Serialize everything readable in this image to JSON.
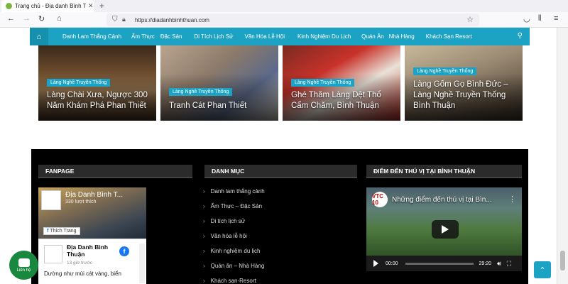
{
  "browser": {
    "tab_title": "Trang chủ - Địa danh Bình Thuận",
    "url": "https://diadanhbinhthuan.com"
  },
  "nav": {
    "items": [
      "Danh Lam Thắng Cảnh",
      "Ẩm Thực",
      "Đặc Sản",
      "Di Tích Lịch Sử",
      "Văn Hóa Lễ Hội",
      "Kinh Nghiệm Du Lịch",
      "Quán Ăn",
      "Nhà Hàng",
      "Khách Sạn Resort"
    ]
  },
  "cards": [
    {
      "tag": "Làng Nghề Truyền Thống",
      "title": "Làng Chài Xưa, Ngược 300 Năm Khám Phá Phan Thiết"
    },
    {
      "tag": "Làng Nghề Truyền Thống",
      "title": "Tranh Cát Phan Thiết"
    },
    {
      "tag": "Làng Nghề Truyền Thống",
      "title": "Ghé Thăm Làng Dệt Thổ Cẩm Chăm, Bình Thuận"
    },
    {
      "tag": "Làng Nghề Truyền Thống",
      "title": "Làng Gốm Gọ Bình Đức – Làng Nghề Truyền Thống Bình Thuận"
    }
  ],
  "footer": {
    "fanpage_title": "FANPAGE",
    "danhmuc_title": "DANH MỤC",
    "diemden_title": "ĐIỂM ĐẾN THÚ VỊ TẠI BÌNH THUẬN",
    "categories": [
      "Danh lam thắng cảnh",
      "Ẩm Thực – Đặc Sản",
      "Di tích lịch sử",
      "Văn hóa lễ hội",
      "Kinh nghiệm du lịch",
      "Quán ăn – Nhà Hàng",
      "Khách sạn-Resort"
    ]
  },
  "facebook": {
    "page_name": "Địa Danh Bình T...",
    "likes": "330 lượt thích",
    "like_label": "Thích Trang",
    "post_name": "Địa Danh Bình Thuận",
    "post_time": "13 giờ trước",
    "post_text": "Dường như mùi cát vàng, biển"
  },
  "video": {
    "logo": "VTC 10",
    "title": "Những điểm đến thú vị tại Bìn...",
    "current": "00:00",
    "duration": "29:20"
  },
  "chat": {
    "label": "Liên hệ"
  }
}
